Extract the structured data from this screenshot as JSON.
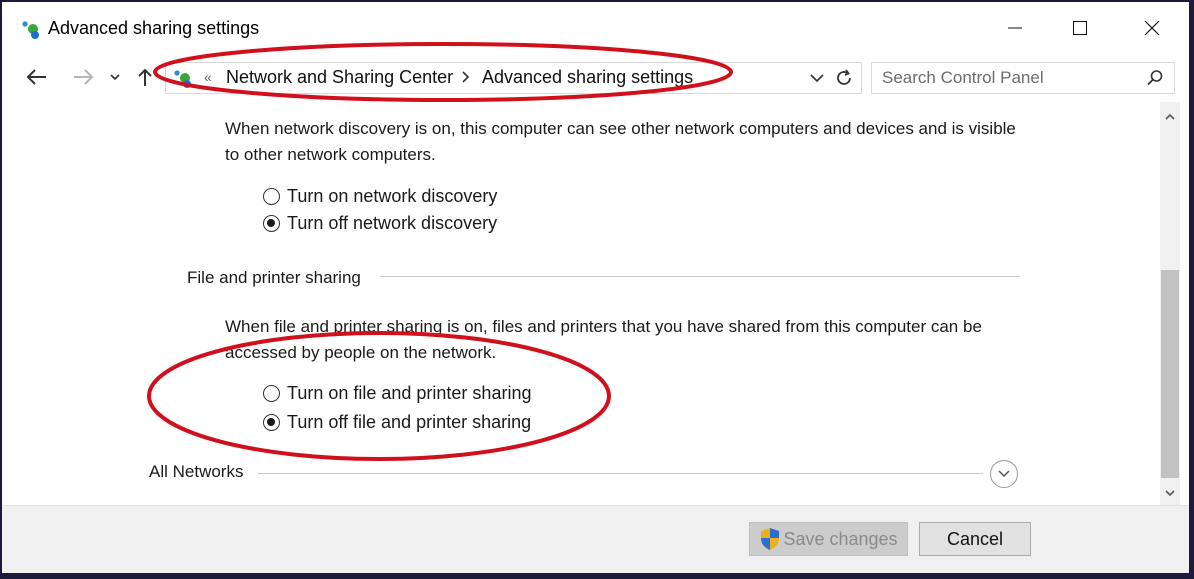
{
  "window": {
    "title": "Advanced sharing settings"
  },
  "address": {
    "breadcrumbs": [
      "Network and Sharing Center",
      "Advanced sharing settings"
    ],
    "overflow_chevron": "«"
  },
  "search": {
    "placeholder": "Search Control Panel"
  },
  "network_discovery": {
    "description": "When network discovery is on, this computer can see other network computers and devices and is visible to other network computers.",
    "options": [
      {
        "label": "Turn on network discovery",
        "checked": false
      },
      {
        "label": "Turn off network discovery",
        "checked": true
      }
    ]
  },
  "file_printer_sharing": {
    "heading": "File and printer sharing",
    "description": "When file and printer sharing is on, files and printers that you have shared from this computer can be accessed by people on the network.",
    "options": [
      {
        "label": "Turn on file and printer sharing",
        "checked": false
      },
      {
        "label": "Turn off file and printer sharing",
        "checked": true
      }
    ]
  },
  "all_networks": {
    "heading": "All Networks"
  },
  "footer": {
    "save_label": "Save changes",
    "cancel_label": "Cancel"
  },
  "colors": {
    "annotation": "#d0101c",
    "window_bg": "#ffffff",
    "footer_bg": "#f0f0f0",
    "frame": "#1b1a3a"
  },
  "icons": [
    "network-icon",
    "minimize-icon",
    "maximize-icon",
    "close-icon",
    "back-arrow-icon",
    "forward-arrow-icon",
    "recent-dropdown-icon",
    "up-arrow-icon",
    "refresh-icon",
    "search-icon",
    "shield-icon",
    "expand-chevron-icon"
  ]
}
